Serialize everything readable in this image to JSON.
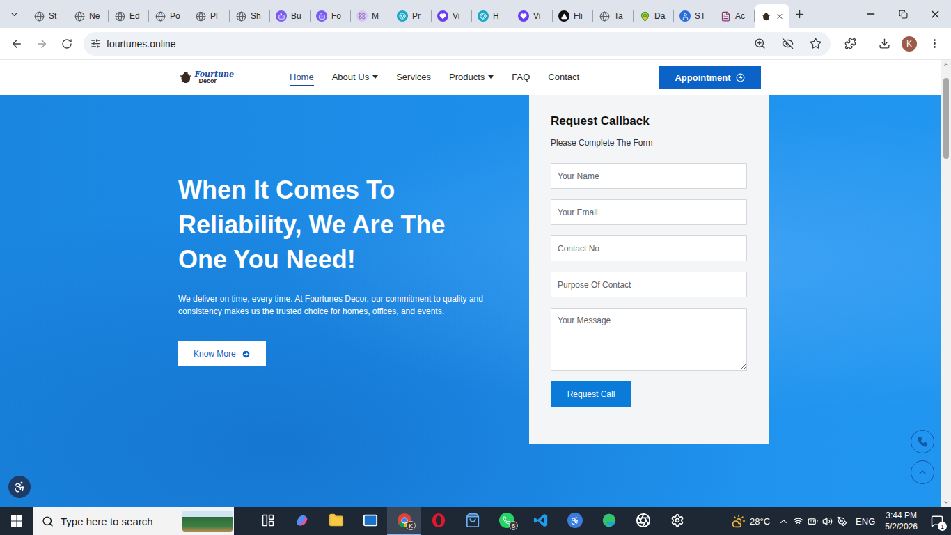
{
  "browser": {
    "tabs": [
      {
        "label": "St",
        "kind": "globe",
        "selected": false
      },
      {
        "label": "Ne",
        "kind": "globe",
        "selected": false
      },
      {
        "label": "Ed",
        "kind": "globe",
        "selected": false
      },
      {
        "label": "Po",
        "kind": "globe",
        "selected": false
      },
      {
        "label": "Pl",
        "kind": "globe",
        "selected": false
      },
      {
        "label": "Sh",
        "kind": "globe",
        "selected": false
      },
      {
        "label": "Bu",
        "kind": "bot",
        "selected": false
      },
      {
        "label": "Fo",
        "kind": "bot",
        "selected": false
      },
      {
        "label": "M",
        "kind": "grid",
        "selected": false
      },
      {
        "label": "Pr",
        "kind": "canva",
        "selected": false
      },
      {
        "label": "Vi",
        "kind": "heart",
        "selected": false
      },
      {
        "label": "H",
        "kind": "canva",
        "selected": false
      },
      {
        "label": "Vi",
        "kind": "heart",
        "selected": false
      },
      {
        "label": "Fli",
        "kind": "delta",
        "selected": false
      },
      {
        "label": "Ta",
        "kind": "globe",
        "selected": false
      },
      {
        "label": "Da",
        "kind": "pin",
        "selected": false
      },
      {
        "label": "ST",
        "kind": "person",
        "selected": false
      },
      {
        "label": "Ac",
        "kind": "doc",
        "selected": false
      },
      {
        "label": "",
        "kind": "vase",
        "selected": true
      }
    ],
    "url": "fourtunes.online",
    "profile": "K"
  },
  "site": {
    "logo": {
      "name": "Fourtune",
      "sub": "Decor"
    },
    "nav": [
      {
        "label": "Home",
        "selected": true,
        "dropdown": false
      },
      {
        "label": "About Us",
        "selected": false,
        "dropdown": true
      },
      {
        "label": "Services",
        "selected": false,
        "dropdown": false
      },
      {
        "label": "Products",
        "selected": false,
        "dropdown": true
      },
      {
        "label": "FAQ",
        "selected": false,
        "dropdown": false
      },
      {
        "label": "Contact",
        "selected": false,
        "dropdown": false
      }
    ],
    "cta": "Appointment",
    "hero": {
      "heading_lines": [
        "When It Comes To",
        "Reliability, We Are The",
        "One You Need!"
      ],
      "text": "We deliver on time, every time. At Fourtunes Decor, our commitment to quality and consistency makes us the trusted choice for homes, offices, and events.",
      "button": "Know More"
    },
    "form": {
      "title": "Request Callback",
      "subtitle": "Please Complete The Form",
      "fields": [
        {
          "placeholder": "Your Name",
          "kind": "input"
        },
        {
          "placeholder": "Your Email",
          "kind": "input"
        },
        {
          "placeholder": "Contact No",
          "kind": "input"
        },
        {
          "placeholder": "Purpose Of Contact",
          "kind": "input"
        },
        {
          "placeholder": "Your Message",
          "kind": "textarea"
        }
      ],
      "button": "Request Call"
    }
  },
  "taskbar": {
    "search": "Type here to search",
    "apps": [
      {
        "kind": "taskview",
        "badge": "",
        "active": false
      },
      {
        "kind": "copilot",
        "badge": "",
        "active": false
      },
      {
        "kind": "explorer",
        "badge": "",
        "active": false
      },
      {
        "kind": "outlook",
        "badge": "",
        "active": false
      },
      {
        "kind": "chrome",
        "badge": "K",
        "active": true
      },
      {
        "kind": "opera",
        "badge": "",
        "active": false
      },
      {
        "kind": "store",
        "badge": "",
        "active": false
      },
      {
        "kind": "whatsapp",
        "badge": "6",
        "active": false
      },
      {
        "kind": "vscode",
        "badge": "",
        "active": false
      },
      {
        "kind": "app",
        "badge": "",
        "active": false
      },
      {
        "kind": "edge",
        "badge": "",
        "active": false
      },
      {
        "kind": "chatgpt",
        "badge": "",
        "active": false
      },
      {
        "kind": "settings",
        "badge": "",
        "active": false
      }
    ],
    "weather": "28°C",
    "language": "ENG",
    "time": "3:44 PM",
    "date": "5/2/2026",
    "notifications": "1"
  }
}
